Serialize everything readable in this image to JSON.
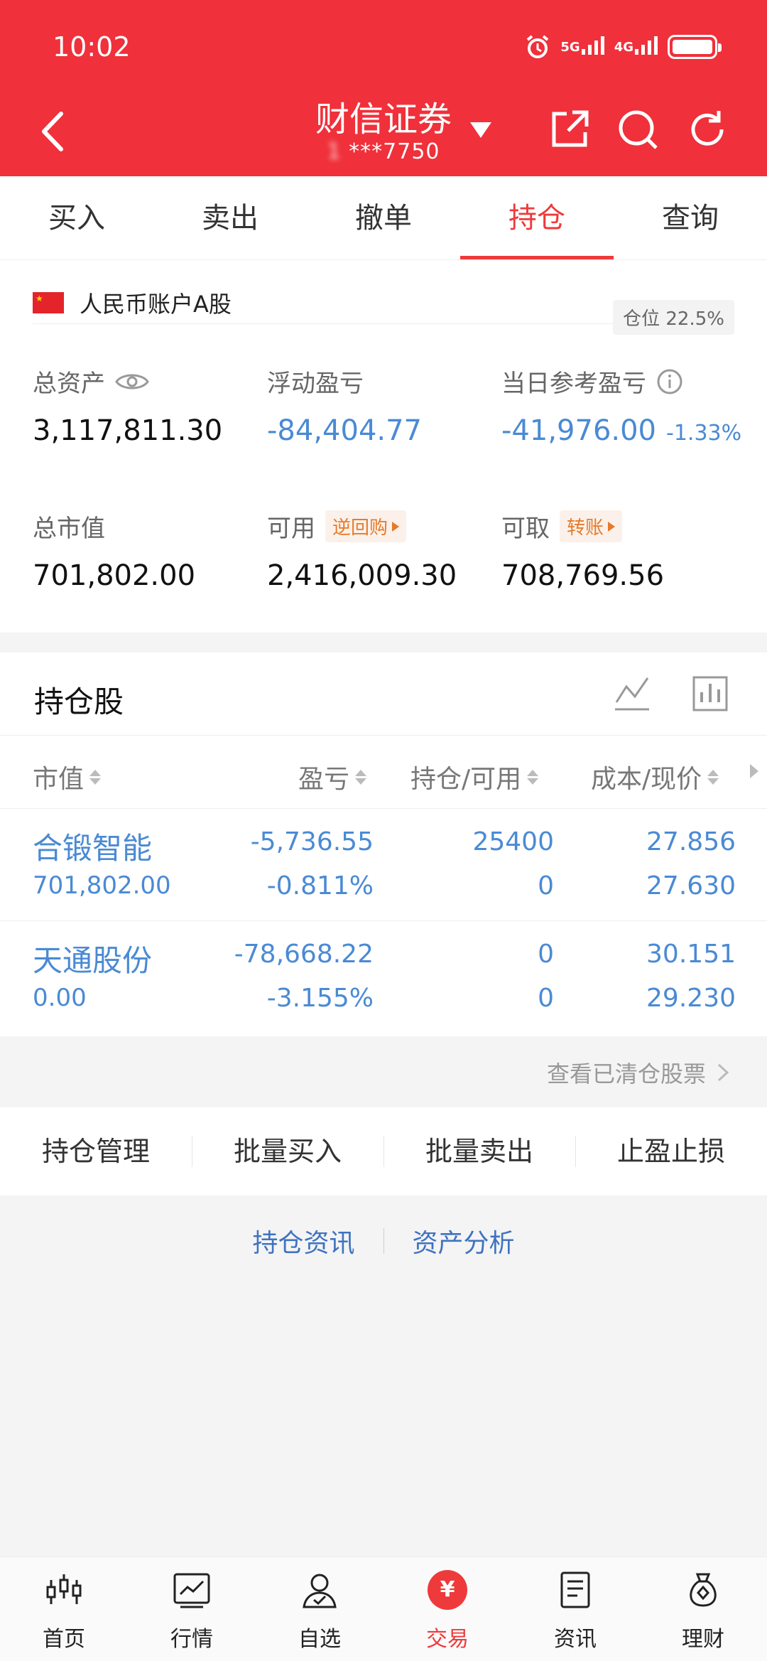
{
  "status_bar": {
    "time": "10:02",
    "net1": "5G",
    "net2": "4G"
  },
  "header": {
    "title": "财信证券",
    "account_masked": "***7750",
    "account_prefix": "1"
  },
  "tabs": [
    "买入",
    "卖出",
    "撤单",
    "持仓",
    "查询"
  ],
  "account": {
    "name": "人民币账户A股",
    "position_label": "仓位 22.5%"
  },
  "metrics": {
    "total_assets": {
      "label": "总资产",
      "value": "3,117,811.30"
    },
    "floating_pl": {
      "label": "浮动盈亏",
      "value": "-84,404.77"
    },
    "daily_pl": {
      "label": "当日参考盈亏",
      "value": "-41,976.00",
      "pct": "-1.33%"
    },
    "market_value": {
      "label": "总市值",
      "value": "701,802.00"
    },
    "available": {
      "label": "可用",
      "tag": "逆回购",
      "value": "2,416,009.30"
    },
    "withdrawable": {
      "label": "可取",
      "tag": "转账",
      "value": "708,769.56"
    }
  },
  "holdings": {
    "title": "持仓股",
    "columns": [
      "市值",
      "盈亏",
      "持仓/可用",
      "成本/现价"
    ],
    "rows": [
      {
        "name": "合锻智能",
        "market_value": "701,802.00",
        "pl": "-5,736.55",
        "pl_pct": "-0.811%",
        "qty": "25400",
        "avail": "0",
        "cost": "27.856",
        "price": "27.630"
      },
      {
        "name": "天通股份",
        "market_value": "0.00",
        "pl": "-78,668.22",
        "pl_pct": "-3.155%",
        "qty": "0",
        "avail": "0",
        "cost": "30.151",
        "price": "29.230"
      }
    ],
    "cleared_link": "查看已清仓股票"
  },
  "actions": [
    "持仓管理",
    "批量买入",
    "批量卖出",
    "止盈止损"
  ],
  "links": [
    "持仓资讯",
    "资产分析"
  ],
  "bottom_nav": [
    {
      "label": "首页",
      "icon": "candlestick-icon"
    },
    {
      "label": "行情",
      "icon": "chart-icon"
    },
    {
      "label": "自选",
      "icon": "user-check-icon"
    },
    {
      "label": "交易",
      "icon": "yen-icon"
    },
    {
      "label": "资讯",
      "icon": "document-icon"
    },
    {
      "label": "理财",
      "icon": "money-bag-icon"
    }
  ],
  "colors": {
    "brand_red": "#f0303a",
    "loss_blue": "#4a8ad4",
    "tag_orange": "#e77a2a"
  }
}
